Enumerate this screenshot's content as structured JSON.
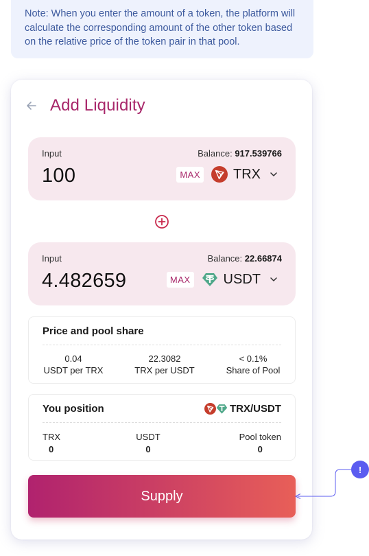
{
  "note": {
    "text": "Note: When you enter the amount of a token, the platform will calculate the corresponding amount of the other token based on the relative price of the token pair in that pool."
  },
  "header": {
    "title": "Add Liquidity"
  },
  "input_one": {
    "label": "Input",
    "balance_label": "Balance:",
    "balance_value": "917.539766",
    "amount": "100",
    "max_label": "MAX",
    "token": "TRX"
  },
  "input_two": {
    "label": "Input",
    "balance_label": "Balance:",
    "balance_value": "22.66874",
    "amount": "4.482659",
    "max_label": "MAX",
    "token": "USDT"
  },
  "price_share": {
    "title": "Price and pool share",
    "stats": [
      {
        "value": "0.04",
        "label": "USDT per TRX"
      },
      {
        "value": "22.3082",
        "label": "TRX per USDT"
      },
      {
        "value": "< 0.1%",
        "label": "Share of Pool"
      }
    ]
  },
  "position": {
    "title": "You position",
    "pair": "TRX/USDT",
    "columns": [
      {
        "label": "TRX",
        "value": "0"
      },
      {
        "label": "USDT",
        "value": "0"
      },
      {
        "label": "Pool token",
        "value": "0"
      }
    ]
  },
  "supply_label": "Supply",
  "hint_badge": "!",
  "colors": {
    "accent": "#a8276a",
    "input_bg": "#f7e8ee",
    "note_bg": "#eef2fd",
    "note_text": "#3d5a9e",
    "trx": "#c53d2c",
    "usdt": "#50a88a",
    "hint": "#5b5cf0"
  },
  "icons": [
    "back-arrow-icon",
    "trx-token-icon",
    "usdt-token-icon",
    "chevron-down-icon",
    "plus-circle-icon",
    "info-hint-icon"
  ]
}
